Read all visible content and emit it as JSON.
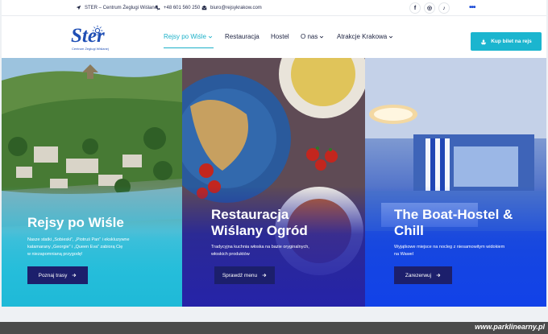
{
  "topbar": {
    "address": "STER – Centrum Żeglugi Wiślanej",
    "phone": "+48 601 560 250",
    "email": "biuro@rejsykrakow.com",
    "social": [
      {
        "icon": "facebook-icon",
        "glyph": "f"
      },
      {
        "icon": "instagram-icon",
        "glyph": "◎"
      },
      {
        "icon": "tiktok-icon",
        "glyph": "♪"
      }
    ],
    "more": "•••"
  },
  "logo": {
    "name": "Ster",
    "tagline": "Centrum Żeglugi Wiślanej"
  },
  "nav": {
    "items": [
      {
        "label": "Rejsy po Wiśle",
        "active": true,
        "dropdown": true
      },
      {
        "label": "Restauracja",
        "active": false,
        "dropdown": false
      },
      {
        "label": "Hostel",
        "active": false,
        "dropdown": false
      },
      {
        "label": "O nas",
        "active": false,
        "dropdown": true
      },
      {
        "label": "Atrakcje Krakowa",
        "active": false,
        "dropdown": true
      }
    ],
    "cta": "Kup bilet na rejs"
  },
  "panels": [
    {
      "title_lines": [
        "Rejsy po Wiśle"
      ],
      "desc_lines": [
        "Nasze statki „Sobieski”, „Piotruś Pan” i ekskluzywne",
        "katamarany „Georgie” i „Queen Eva” zabiorą Cię",
        "w niezapomnianą przygodę!"
      ],
      "button": "Poznaj trasy"
    },
    {
      "title_lines": [
        "Restauracja",
        "Wiślany Ogród"
      ],
      "desc_lines": [
        "Tradycyjna kuchnia włoska na bazie oryginalnych,",
        "włoskich produktów"
      ],
      "button": "Sprawdź menu"
    },
    {
      "title_lines": [
        "The Boat-Hostel &",
        "Chill"
      ],
      "desc_lines": [
        "Wyjątkowe miejsce na nocleg z niesamowitym widokiem",
        "na Wawel"
      ],
      "button": "Zarezerwuj"
    }
  ],
  "watermark": "www.parklinearny.pl",
  "colors": {
    "accent": "#1bb5cf",
    "navy": "#1c1f6c",
    "logo": "#1f4fb5"
  }
}
